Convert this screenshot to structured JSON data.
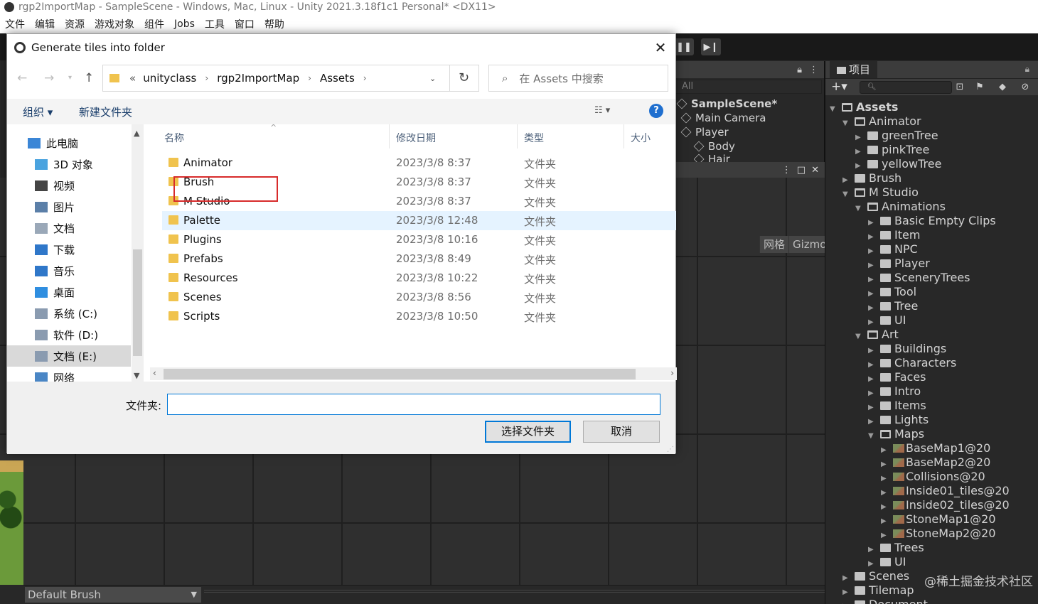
{
  "unity": {
    "window_title": "rgp2ImportMap - SampleScene - Windows, Mac, Linux - Unity 2021.3.18f1c1 Personal* <DX11>",
    "menu": [
      "文件",
      "编辑",
      "资源",
      "游戏对象",
      "组件",
      "Jobs",
      "工具",
      "窗口",
      "帮助"
    ],
    "hierarchy": {
      "search_text": "All",
      "rows": [
        "SampleScene*",
        "Main Camera",
        "Player",
        "Body",
        "Hair"
      ]
    },
    "scene_view": {
      "grid_label": "网格",
      "gizmos_label": "Gizmos"
    },
    "brush_dropdown": "Default Brush",
    "project": {
      "tab_label": "项目",
      "tree": [
        {
          "label": "Assets"
        },
        {
          "label": "Animator"
        },
        {
          "label": "greenTree"
        },
        {
          "label": "pinkTree"
        },
        {
          "label": "yellowTree"
        },
        {
          "label": "Brush"
        },
        {
          "label": "M Studio"
        },
        {
          "label": "Animations"
        },
        {
          "label": "Basic Empty Clips"
        },
        {
          "label": "Item"
        },
        {
          "label": "NPC"
        },
        {
          "label": "Player"
        },
        {
          "label": "SceneryTrees"
        },
        {
          "label": "Tool"
        },
        {
          "label": "Tree"
        },
        {
          "label": "UI"
        },
        {
          "label": "Art"
        },
        {
          "label": "Buildings"
        },
        {
          "label": "Characters"
        },
        {
          "label": "Faces"
        },
        {
          "label": "Intro"
        },
        {
          "label": "Items"
        },
        {
          "label": "Lights"
        },
        {
          "label": "Maps"
        },
        {
          "label": "BaseMap1@20"
        },
        {
          "label": "BaseMap2@20"
        },
        {
          "label": "Collisions@20"
        },
        {
          "label": "Inside01_tiles@20"
        },
        {
          "label": "Inside02_tiles@20"
        },
        {
          "label": "StoneMap1@20"
        },
        {
          "label": "StoneMap2@20"
        },
        {
          "label": "Trees"
        },
        {
          "label": "UI"
        },
        {
          "label": "Scenes"
        },
        {
          "label": "Tilemap"
        },
        {
          "label": "Document"
        }
      ]
    },
    "watermark": "@稀土掘金技术社区"
  },
  "dialog": {
    "title": "Generate tiles into folder",
    "breadcrumb": [
      "unityclass",
      "rgp2ImportMap",
      "Assets"
    ],
    "breadcrumb_prefix": "«",
    "search_placeholder": "在 Assets 中搜索",
    "organize_label": "组织 ▾",
    "new_folder_label": "新建文件夹",
    "help_label": "?",
    "nav_items": [
      {
        "label": "此电脑",
        "icon": "computer-icon"
      },
      {
        "label": "3D 对象",
        "icon": "cube-3d-icon"
      },
      {
        "label": "视频",
        "icon": "video-icon"
      },
      {
        "label": "图片",
        "icon": "picture-icon"
      },
      {
        "label": "文档",
        "icon": "document-icon"
      },
      {
        "label": "下载",
        "icon": "download-icon"
      },
      {
        "label": "音乐",
        "icon": "music-icon"
      },
      {
        "label": "桌面",
        "icon": "desktop-icon"
      },
      {
        "label": "系统 (C:)",
        "icon": "drive-icon"
      },
      {
        "label": "软件 (D:)",
        "icon": "drive-icon"
      },
      {
        "label": "文档 (E:)",
        "icon": "drive-icon"
      },
      {
        "label": "网络",
        "icon": "network-icon"
      }
    ],
    "columns": {
      "name": "名称",
      "date": "修改日期",
      "type": "类型",
      "size": "大小"
    },
    "files": [
      {
        "name": "Animator",
        "date": "2023/3/8 8:37",
        "type": "文件夹"
      },
      {
        "name": "Brush",
        "date": "2023/3/8 8:37",
        "type": "文件夹"
      },
      {
        "name": "M Studio",
        "date": "2023/3/8 8:37",
        "type": "文件夹"
      },
      {
        "name": "Palette",
        "date": "2023/3/8 12:48",
        "type": "文件夹"
      },
      {
        "name": "Plugins",
        "date": "2023/3/8 10:16",
        "type": "文件夹"
      },
      {
        "name": "Prefabs",
        "date": "2023/3/8 8:49",
        "type": "文件夹"
      },
      {
        "name": "Resources",
        "date": "2023/3/8 10:22",
        "type": "文件夹"
      },
      {
        "name": "Scenes",
        "date": "2023/3/8 8:56",
        "type": "文件夹"
      },
      {
        "name": "Scripts",
        "date": "2023/3/8 10:50",
        "type": "文件夹"
      }
    ],
    "hovered_row": "Palette",
    "folder_label": "文件夹:",
    "folder_value": "",
    "select_button": "选择文件夹",
    "cancel_button": "取消",
    "accent_color": "#0078d7",
    "highlight_color": "#d72b2b"
  }
}
